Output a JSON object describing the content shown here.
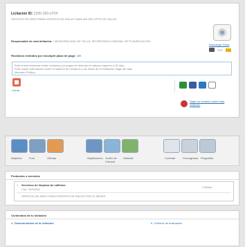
{
  "licitacion": {
    "id_label": "Licitación ID:",
    "id_value": "2295-183-LP24",
    "subtitle": "SERVICIO DE ASEO PARA CENTROS DE SALUD FAMILIAR DEL DPTO DE SALUD",
    "responsable_label": "Responsable de esta licitación:",
    "responsable_value": "I MUNICIPALIDAD DE TALCA, SECRETARIA COMUNAL DE PLANIFICACION",
    "reclamos_label": "Reclamos recibidos por incumplir plazo de pago:",
    "reclamos_value": "189",
    "notice_text": "Esta nueva instancia recibe reclamos por pagos de facturas en plazos mayores a 30 días.",
    "notice_text2": "Para mayor información sobre el sistema de reclamos y los datos de la institución haga clic aquí.",
    "notice_text3": "Mercado Público.",
    "descargar_label": "Descargar Ficha",
    "pdf_label": "PDF",
    "cerrar_label": "Cerrar",
    "reclamo_link": "Dejar un reclamo sobre esta licitación"
  },
  "toolbar": {
    "items": [
      {
        "label": "Adjuntos"
      },
      {
        "label": "Foro"
      },
      {
        "label": "Ofertas"
      },
      {
        "label": "Adjudicación"
      },
      {
        "label": "Orden de Compra"
      },
      {
        "label": "Historial"
      },
      {
        "label": "Contrato"
      },
      {
        "label": "Cronograma"
      },
      {
        "label": "Preguntas"
      },
      {
        "label": "Reclamos"
      }
    ]
  },
  "productos": {
    "title": "Productos o servicios",
    "item_code": "1",
    "item_name": "Servicios de limpieza de edificios",
    "item_sub": "Cod: 76111501",
    "qty_label": "1 Global",
    "description": "SERVICIO DE ASEO PARA CENTROS DE SALUD POR 12 MESES"
  },
  "contenidos": {
    "title": "Contenidos de tu licitación",
    "item1": "1. Características de la licitación",
    "item5": "6. Criterios de evaluación"
  },
  "colors": {
    "accent_blue": "#2a6fb0",
    "panel_border": "#cfcfcf",
    "notice_border": "#a9c7e4"
  }
}
